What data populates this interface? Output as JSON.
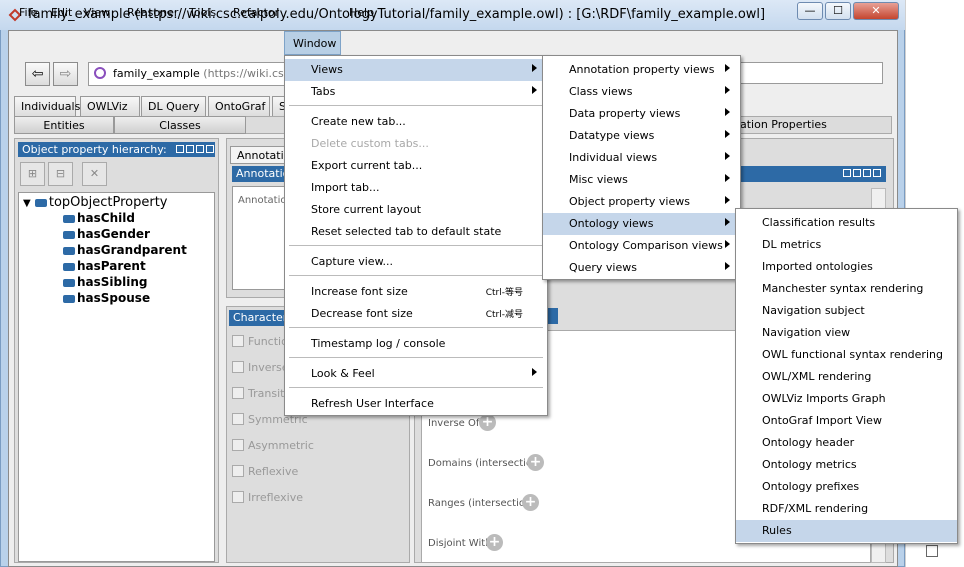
{
  "window": {
    "title": "family_example (https://wiki.csc.calpoly.edu/OntologyTutorial/family_example.owl)  : [G:\\RDF\\family_example.owl]",
    "min": "—",
    "max": "☐",
    "close": "✕"
  },
  "menubar": [
    "File",
    "Edit",
    "View",
    "Reasoner",
    "Tools",
    "Refactor",
    "Window",
    "Help"
  ],
  "toolbar": {
    "back": "⇦",
    "forward": "⇨",
    "ontology_name": "family_example",
    "ontology_iri": "(https://wiki.csc.cal"
  },
  "tabs_top": [
    "Individuals",
    "OWLViz",
    "DL Query",
    "OntoGraf",
    "S"
  ],
  "tabs_sub": [
    "Entities",
    "Classes"
  ],
  "right_tab_label": "ation Properties",
  "hierarchy": {
    "header": "Object property hierarchy:",
    "root": "topObjectProperty",
    "children": [
      "hasChild",
      "hasGender",
      "hasGrandparent",
      "hasParent",
      "hasSibling",
      "hasSpouse"
    ]
  },
  "annotations": {
    "tab": "Annotatio",
    "header": "Annotation",
    "body": "Annotations"
  },
  "characteristics": {
    "header": "Characteri",
    "items": [
      "Functio",
      "Inverse",
      "Transiti",
      "Symmetric",
      "Asymmetric",
      "Reflexive",
      "Irreflexive"
    ]
  },
  "description": {
    "items": [
      "Inverse Of",
      "Domains (intersection)",
      "Ranges (intersection)",
      "Disjoint With"
    ]
  },
  "window_menu": {
    "items": [
      {
        "label": "Views",
        "sub": true,
        "hl": true
      },
      {
        "label": "Tabs",
        "sub": true
      },
      {
        "label": "Create new tab..."
      },
      {
        "label": "Delete custom tabs...",
        "disabled": true
      },
      {
        "label": "Export current tab..."
      },
      {
        "label": "Import tab..."
      },
      {
        "label": "Store current layout"
      },
      {
        "label": "Reset selected tab to default state"
      },
      {
        "label": "Capture view..."
      },
      {
        "label": "Increase font size",
        "shortcut": "Ctrl-等号"
      },
      {
        "label": "Decrease font size",
        "shortcut": "Ctrl-减号"
      },
      {
        "label": "Timestamp log / console"
      },
      {
        "label": "Look & Feel",
        "sub": true
      },
      {
        "label": "Refresh User Interface"
      }
    ]
  },
  "views_menu": {
    "items": [
      {
        "label": "Annotation property views"
      },
      {
        "label": "Class views"
      },
      {
        "label": "Data property views"
      },
      {
        "label": "Datatype views"
      },
      {
        "label": "Individual views"
      },
      {
        "label": "Misc views"
      },
      {
        "label": "Object property views"
      },
      {
        "label": "Ontology views",
        "hl": true
      },
      {
        "label": "Ontology Comparison views"
      },
      {
        "label": "Query views"
      }
    ]
  },
  "ontology_views_menu": {
    "items": [
      "Classification results",
      "DL metrics",
      "Imported ontologies",
      "Manchester syntax rendering",
      "Navigation subject",
      "Navigation view",
      "OWL functional syntax rendering",
      "OWL/XML rendering",
      "OWLViz Imports Graph",
      "OntoGraf Import View",
      "Ontology header",
      "Ontology metrics",
      "Ontology prefixes",
      "RDF/XML rendering",
      "Rules"
    ],
    "highlighted": "Rules"
  }
}
